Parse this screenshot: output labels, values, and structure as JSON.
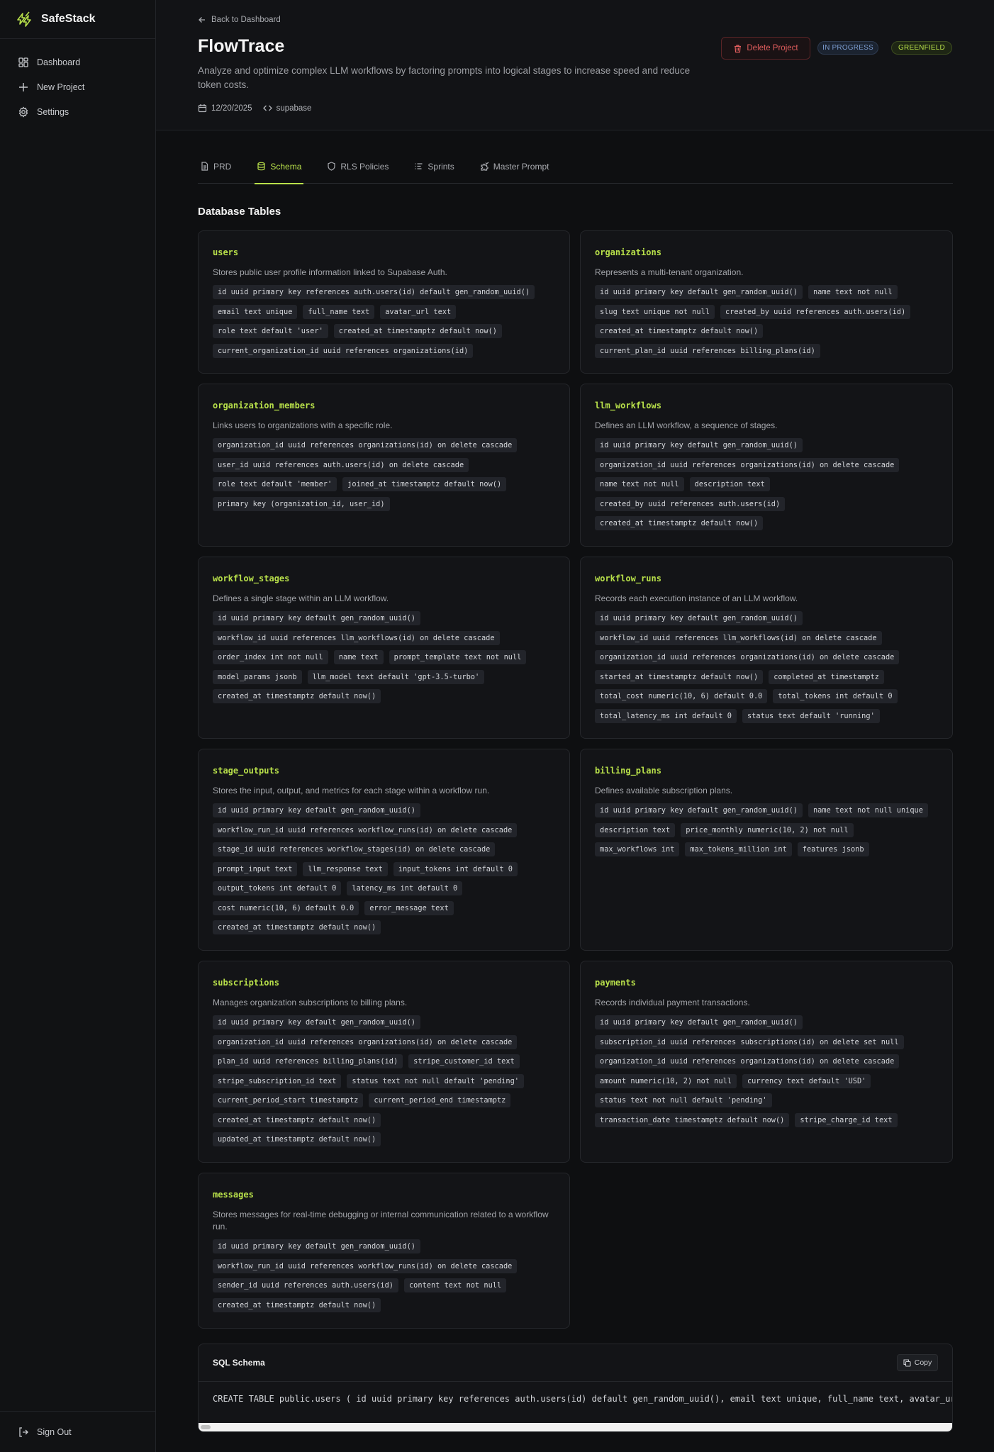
{
  "app": {
    "name": "SafeStack",
    "accent": "#b8e04a"
  },
  "sidebar": {
    "items": [
      {
        "label": "Dashboard",
        "icon": "dashboard-icon"
      },
      {
        "label": "New Project",
        "icon": "plus-icon"
      },
      {
        "label": "Settings",
        "icon": "gear-icon"
      }
    ],
    "signout": "Sign Out"
  },
  "header": {
    "back": "Back to Dashboard",
    "title": "FlowTrace",
    "description": "Analyze and optimize complex LLM workflows by factoring prompts into logical stages to increase speed and reduce token costs.",
    "date": "12/20/2025",
    "stack": "supabase",
    "delete_label": "Delete Project",
    "status_badge": "IN PROGRESS",
    "type_badge": "GREENFIELD"
  },
  "tabs": [
    {
      "label": "PRD",
      "icon": "document-icon"
    },
    {
      "label": "Schema",
      "icon": "database-icon",
      "active": true
    },
    {
      "label": "RLS Policies",
      "icon": "shield-icon"
    },
    {
      "label": "Sprints",
      "icon": "list-icon"
    },
    {
      "label": "Master Prompt",
      "icon": "puzzle-icon"
    }
  ],
  "section_title": "Database Tables",
  "tables": [
    {
      "name": "users",
      "description": "Stores public user profile information linked to Supabase Auth.",
      "columns": [
        "id uuid primary key references auth.users(id) default gen_random_uuid()",
        "email text unique",
        "full_name text",
        "avatar_url text",
        "role text default 'user'",
        "created_at timestamptz default now()",
        "current_organization_id uuid references organizations(id)"
      ]
    },
    {
      "name": "organizations",
      "description": "Represents a multi-tenant organization.",
      "columns": [
        "id uuid primary key default gen_random_uuid()",
        "name text not null",
        "slug text unique not null",
        "created_by uuid references auth.users(id)",
        "created_at timestamptz default now()",
        "current_plan_id uuid references billing_plans(id)"
      ]
    },
    {
      "name": "organization_members",
      "description": "Links users to organizations with a specific role.",
      "columns": [
        "organization_id uuid references organizations(id) on delete cascade",
        "user_id uuid references auth.users(id) on delete cascade",
        "role text default 'member'",
        "joined_at timestamptz default now()",
        "primary key (organization_id, user_id)"
      ]
    },
    {
      "name": "llm_workflows",
      "description": "Defines an LLM workflow, a sequence of stages.",
      "columns": [
        "id uuid primary key default gen_random_uuid()",
        "organization_id uuid references organizations(id) on delete cascade",
        "name text not null",
        "description text",
        "created_by uuid references auth.users(id)",
        "created_at timestamptz default now()"
      ]
    },
    {
      "name": "workflow_stages",
      "description": "Defines a single stage within an LLM workflow.",
      "columns": [
        "id uuid primary key default gen_random_uuid()",
        "workflow_id uuid references llm_workflows(id) on delete cascade",
        "order_index int not null",
        "name text",
        "prompt_template text not null",
        "model_params jsonb",
        "llm_model text default 'gpt-3.5-turbo'",
        "created_at timestamptz default now()"
      ]
    },
    {
      "name": "workflow_runs",
      "description": "Records each execution instance of an LLM workflow.",
      "columns": [
        "id uuid primary key default gen_random_uuid()",
        "workflow_id uuid references llm_workflows(id) on delete cascade",
        "organization_id uuid references organizations(id) on delete cascade",
        "started_at timestamptz default now()",
        "completed_at timestamptz",
        "total_cost numeric(10, 6) default 0.0",
        "total_tokens int default 0",
        "total_latency_ms int default 0",
        "status text default 'running'"
      ]
    },
    {
      "name": "stage_outputs",
      "description": "Stores the input, output, and metrics for each stage within a workflow run.",
      "columns": [
        "id uuid primary key default gen_random_uuid()",
        "workflow_run_id uuid references workflow_runs(id) on delete cascade",
        "stage_id uuid references workflow_stages(id) on delete cascade",
        "prompt_input text",
        "llm_response text",
        "input_tokens int default 0",
        "output_tokens int default 0",
        "latency_ms int default 0",
        "cost numeric(10, 6) default 0.0",
        "error_message text",
        "created_at timestamptz default now()"
      ]
    },
    {
      "name": "billing_plans",
      "description": "Defines available subscription plans.",
      "columns": [
        "id uuid primary key default gen_random_uuid()",
        "name text not null unique",
        "description text",
        "price_monthly numeric(10, 2) not null",
        "max_workflows int",
        "max_tokens_million int",
        "features jsonb"
      ]
    },
    {
      "name": "subscriptions",
      "description": "Manages organization subscriptions to billing plans.",
      "columns": [
        "id uuid primary key default gen_random_uuid()",
        "organization_id uuid references organizations(id) on delete cascade",
        "plan_id uuid references billing_plans(id)",
        "stripe_customer_id text",
        "stripe_subscription_id text",
        "status text not null default 'pending'",
        "current_period_start timestamptz",
        "current_period_end timestamptz",
        "created_at timestamptz default now()",
        "updated_at timestamptz default now()"
      ]
    },
    {
      "name": "payments",
      "description": "Records individual payment transactions.",
      "columns": [
        "id uuid primary key default gen_random_uuid()",
        "subscription_id uuid references subscriptions(id) on delete set null",
        "organization_id uuid references organizations(id) on delete cascade",
        "amount numeric(10, 2) not null",
        "currency text default 'USD'",
        "status text not null default 'pending'",
        "transaction_date timestamptz default now()",
        "stripe_charge_id text"
      ]
    },
    {
      "name": "messages",
      "description": "Stores messages for real-time debugging or internal communication related to a workflow run.",
      "columns": [
        "id uuid primary key default gen_random_uuid()",
        "workflow_run_id uuid references workflow_runs(id) on delete cascade",
        "sender_id uuid references auth.users(id)",
        "content text not null",
        "created_at timestamptz default now()"
      ]
    }
  ],
  "sql": {
    "title": "SQL Schema",
    "copy_label": "Copy",
    "code": "CREATE TABLE public.users ( id uuid primary key references auth.users(id) default gen_random_uuid(), email text unique, full_name text, avatar_url text,"
  }
}
